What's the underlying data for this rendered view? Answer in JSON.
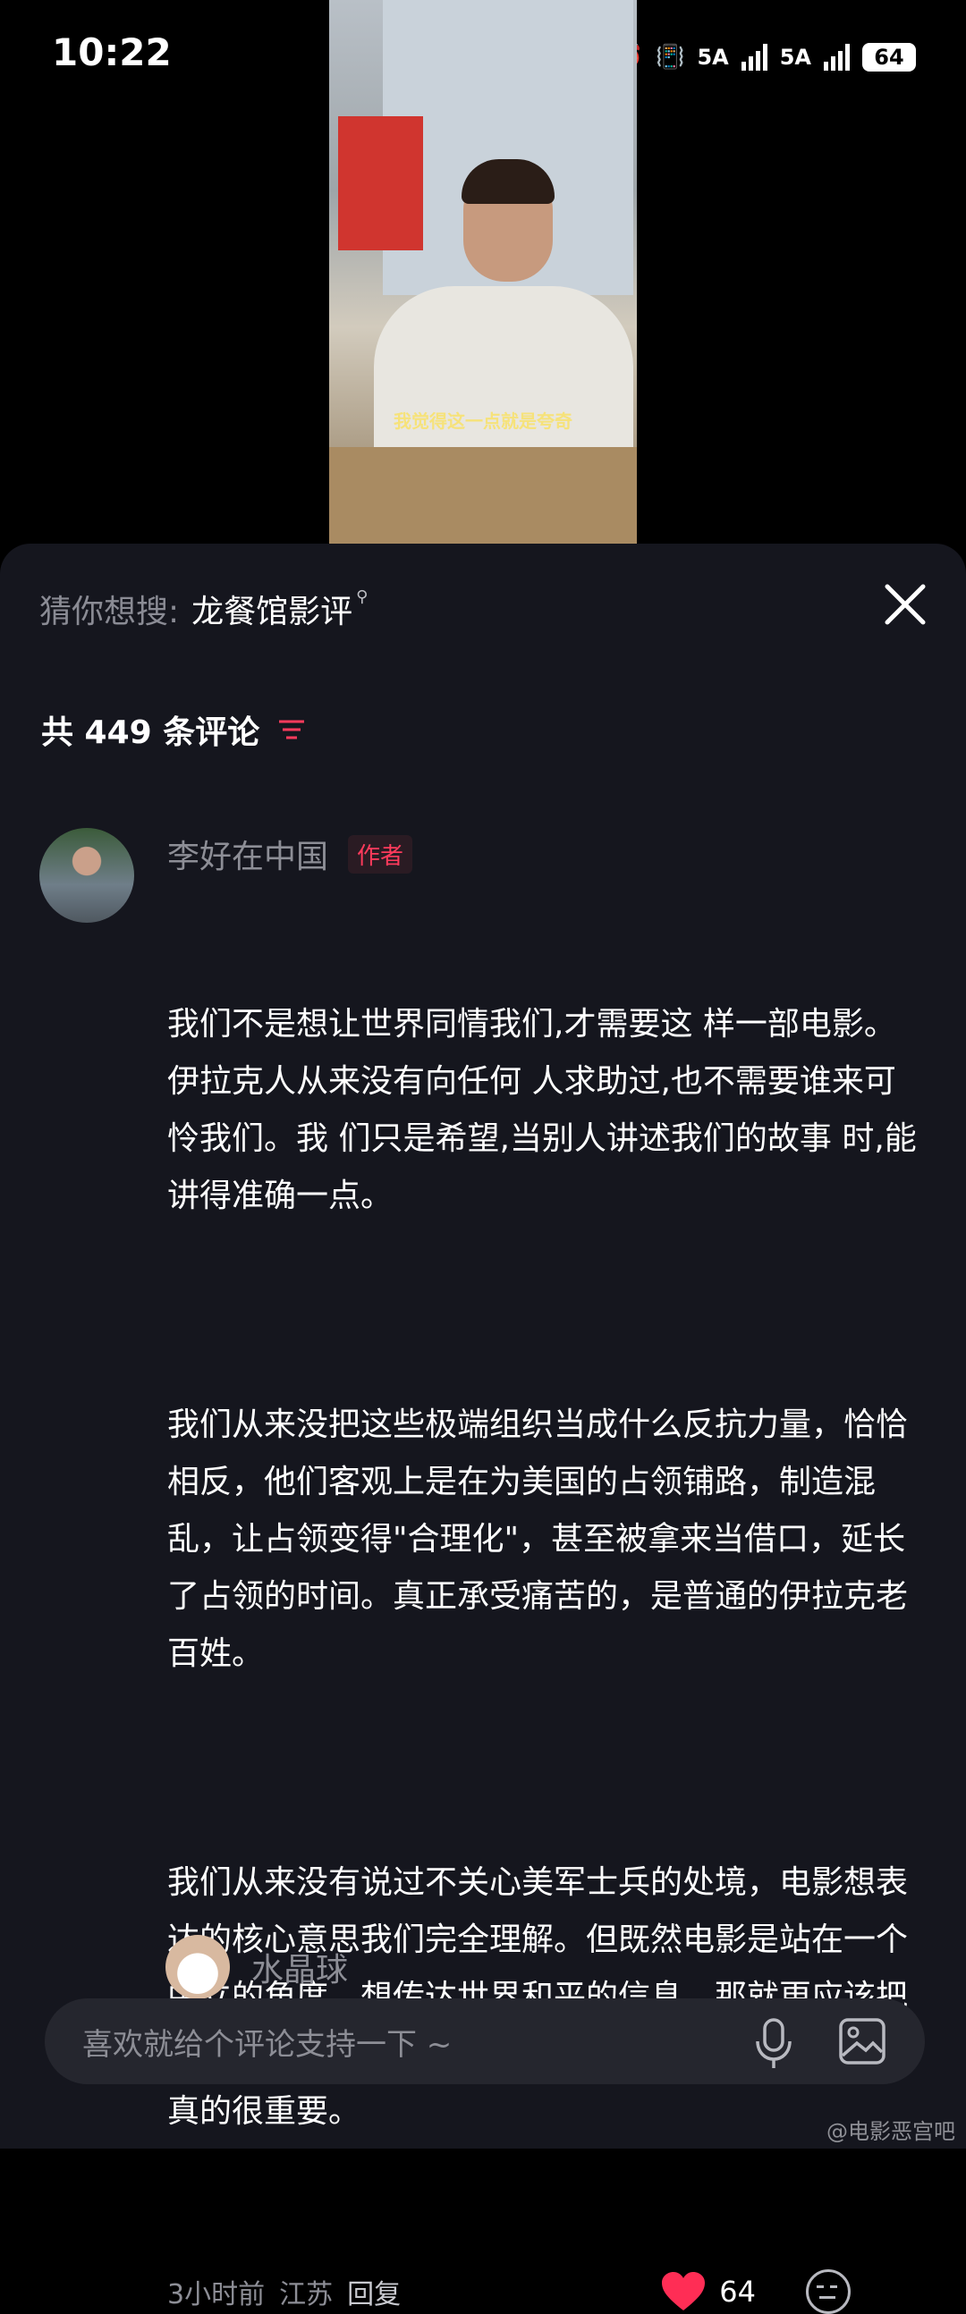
{
  "status_bar": {
    "time": "10:22",
    "network_1": "5A",
    "network_2": "5A",
    "battery": "64"
  },
  "video": {
    "subtitle": "我觉得这一点就是夸奇"
  },
  "search_suggest": {
    "prefix": "猜你想搜:",
    "keyword": "龙餐馆影评"
  },
  "comments_header": {
    "count_label": "共 449 条评论"
  },
  "comment": {
    "username": "李好在中国",
    "badge": "作者",
    "paragraphs": [
      "我们不是想让世界同情我们,才需要这 样一部电影。伊拉克人从来没有向任何 人求助过,也不需要谁来可怜我们。我 们只是希望,当别人讲述我们的故事 时,能讲得准确一点。",
      "我们从来没把这些极端组织当成什么反抗力量，恰恰相反，他们客观上是在为美国的占领铺路，制造混乱，让占领变得\"合理化\"，甚至被拿来当借口，延长了占领的时间。真正承受痛苦的，是普通的伊拉克老百姓。",
      "我们从来没有说过不关心美军士兵的处境，电影想表达的核心意思我们完全理解。但既然电影是站在一个中立的角度，想传达世界和平的信息，那就更应该把事实交代准确，因为你呈现的是别人的历史，准确性真的很重要。"
    ],
    "time": "3小时前",
    "location": "江苏",
    "reply_label": "回复",
    "likes": "64"
  },
  "next_comment": {
    "username": "水晶球"
  },
  "input": {
    "placeholder": "喜欢就给个评论支持一下 ~"
  },
  "watermark": "@电影恶宫吧",
  "colors": {
    "sheet_bg": "#15161e",
    "accent": "#ff3b5c",
    "muted_text": "#8d8e96"
  }
}
